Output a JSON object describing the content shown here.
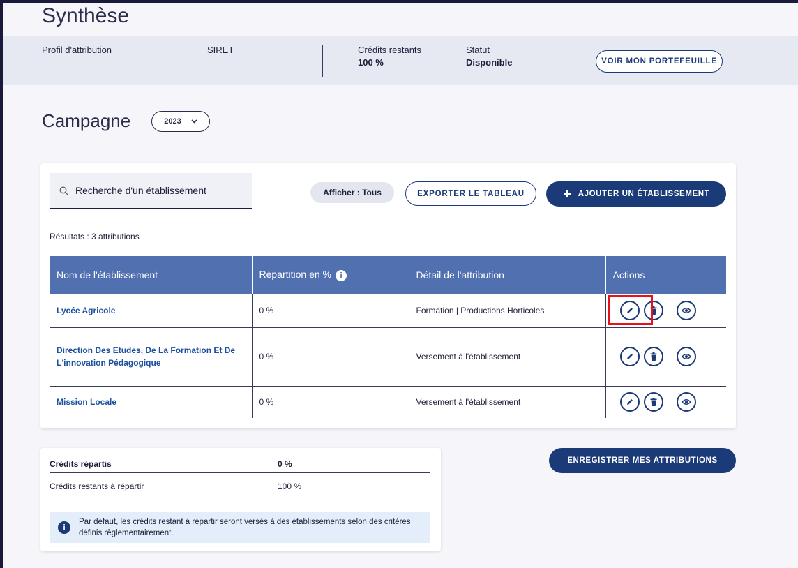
{
  "page": {
    "title": "Synthèse"
  },
  "summary": {
    "profile_label": "Profil d'attribution",
    "siret_label": "SIRET",
    "credits_label": "Crédits restants",
    "credits_value": "100 %",
    "status_label": "Statut",
    "status_value": "Disponible",
    "wallet_button": "VOIR MON PORTEFEUILLE"
  },
  "campaign": {
    "title": "Campagne",
    "year": "2023"
  },
  "toolbar": {
    "search_placeholder": "Recherche d'un établissement",
    "filter_label": "Afficher : Tous",
    "export_button": "EXPORTER LE TABLEAU",
    "add_button": "AJOUTER UN ÉTABLISSEMENT"
  },
  "results": {
    "text": "Résultats : 3 attributions"
  },
  "table": {
    "columns": [
      "Nom de l'établissement",
      "Répartition en %",
      "Détail de l'attribution",
      "Actions"
    ],
    "rows": [
      {
        "name": "Lycée Agricole",
        "percent": "0 %",
        "detail": "Formation | Productions Horticoles"
      },
      {
        "name": "Direction Des Etudes, De La Formation Et De L'innovation Pédagogique",
        "percent": "0 %",
        "detail": "Versement à l'établissement"
      },
      {
        "name": "Mission Locale",
        "percent": "0 %",
        "detail": "Versement à l'établissement"
      }
    ]
  },
  "credits": {
    "allocated_label": "Crédits répartis",
    "allocated_value": "0 %",
    "remaining_label": "Crédits restants à répartir",
    "remaining_value": "100 %",
    "note": "Par défaut, les crédits restant à répartir seront versés à des établissements selon des critères définis règlementairement."
  },
  "save_button": "ENREGISTRER MES ATTRIBUTIONS",
  "colors": {
    "primary": "#1b3a78",
    "header": "#5070b0",
    "highlight": "#e8101a"
  }
}
